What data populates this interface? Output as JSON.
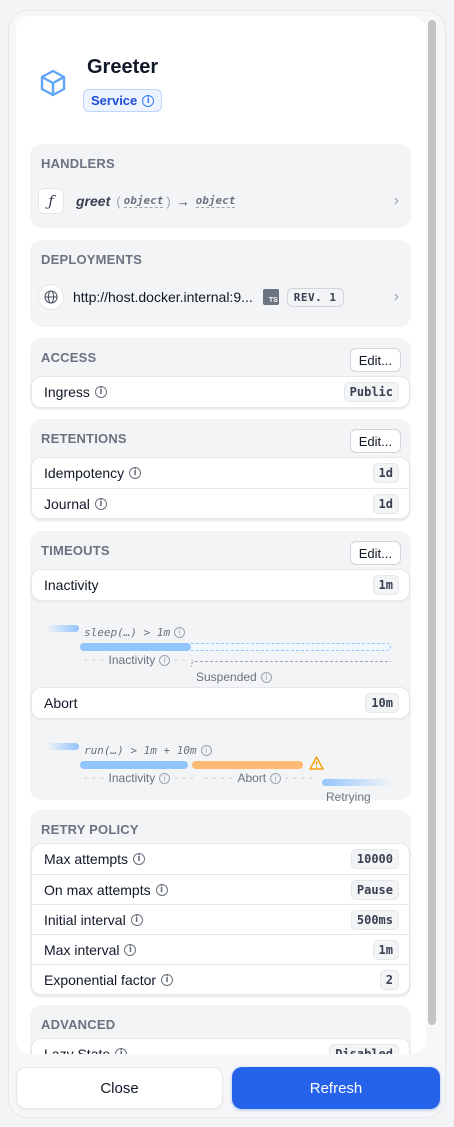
{
  "service": {
    "name": "Greeter",
    "type_badge": "Service"
  },
  "handlers": {
    "title": "HANDLERS",
    "items": [
      {
        "name": "greet",
        "input": "object",
        "output": "object"
      }
    ]
  },
  "deployments": {
    "title": "DEPLOYMENTS",
    "items": [
      {
        "endpoint": "http://host.docker.internal:9...",
        "sdk": "TS",
        "revision": "REV. 1"
      }
    ]
  },
  "access": {
    "title": "ACCESS",
    "edit_label": "Edit...",
    "rows": [
      {
        "label": "Ingress",
        "value": "Public"
      }
    ]
  },
  "retentions": {
    "title": "RETENTIONS",
    "edit_label": "Edit...",
    "rows": [
      {
        "label": "Idempotency",
        "value": "1d"
      },
      {
        "label": "Journal",
        "value": "1d"
      }
    ]
  },
  "timeouts": {
    "title": "TIMEOUTS",
    "edit_label": "Edit...",
    "inactivity": {
      "label": "Inactivity",
      "value": "1m",
      "expr": "sleep(…) > 1m",
      "phase1": "Inactivity",
      "phase2": "Suspended"
    },
    "abort": {
      "label": "Abort",
      "value": "10m",
      "expr": "run(…) > 1m + 10m",
      "phase1": "Inactivity",
      "phase2": "Abort",
      "phase3": "Retrying"
    }
  },
  "retry_policy": {
    "title": "RETRY POLICY",
    "rows": [
      {
        "label": "Max attempts",
        "value": "10000"
      },
      {
        "label": "On max attempts",
        "value": "Pause"
      },
      {
        "label": "Initial interval",
        "value": "500ms"
      },
      {
        "label": "Max interval",
        "value": "1m"
      },
      {
        "label": "Exponential factor",
        "value": "2"
      }
    ]
  },
  "advanced": {
    "title": "ADVANCED",
    "rows": [
      {
        "label": "Lazy State",
        "value": "Disabled"
      }
    ]
  },
  "footer": {
    "close_label": "Close",
    "refresh_label": "Refresh"
  },
  "colors": {
    "accent": "#2563eb",
    "bar_blue": "#93c5fd",
    "bar_orange": "#fdba74",
    "warning": "#f59e0b"
  }
}
